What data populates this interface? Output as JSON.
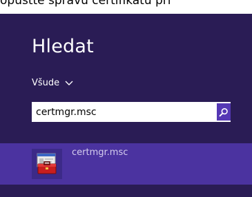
{
  "top_caption": "opustte spravu certifikatu pri",
  "search_panel": {
    "heading": "Hledat",
    "scope_label": "Všude",
    "query": "certmgr.msc"
  },
  "results": [
    {
      "label": "certmgr.msc",
      "icon": "mmc-toolbox-icon"
    }
  ],
  "colors": {
    "panel_bg": "#2a1c55",
    "result_highlight": "#4b33a0",
    "search_button": "#5538b5"
  }
}
